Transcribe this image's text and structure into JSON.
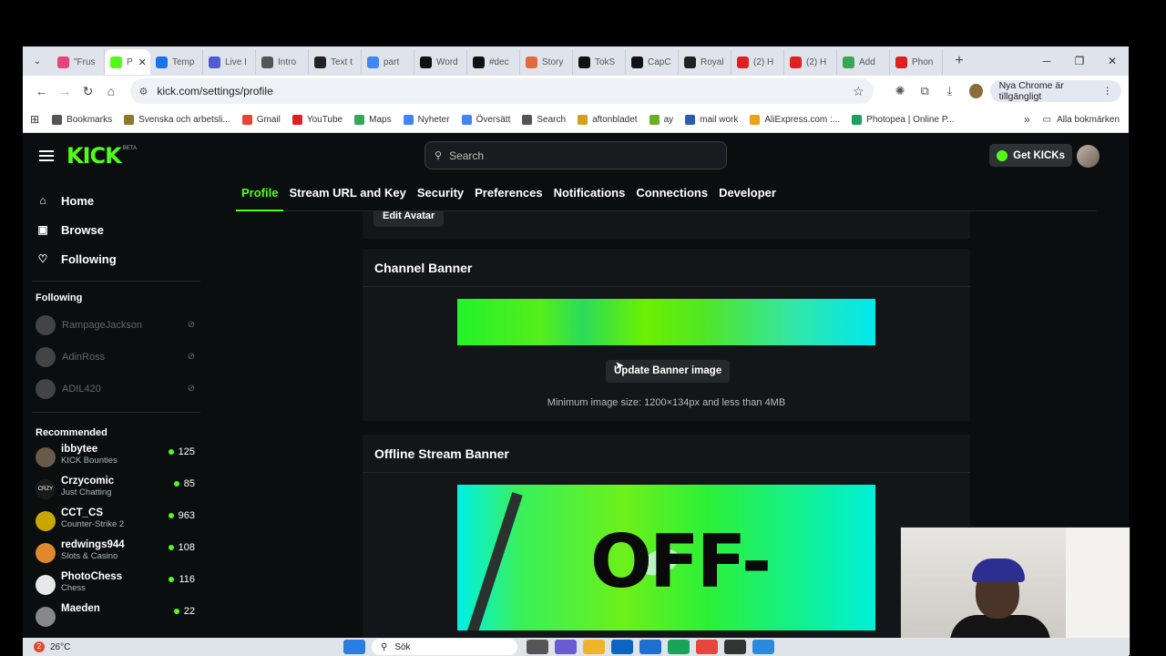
{
  "browser": {
    "tabs": [
      {
        "label": "\"Frus",
        "color": "#e8427a"
      },
      {
        "label": "P",
        "color": "#53fc18",
        "active": true
      },
      {
        "label": "Temp",
        "color": "#1a73e8"
      },
      {
        "label": "Live I",
        "color": "#4f5bd5"
      },
      {
        "label": "Intro",
        "color": "#555555"
      },
      {
        "label": "Text t",
        "color": "#222222"
      },
      {
        "label": "part",
        "color": "#4285f4"
      },
      {
        "label": "Word",
        "color": "#111111"
      },
      {
        "label": "#dec",
        "color": "#111111"
      },
      {
        "label": "Story",
        "color": "#e26a3a"
      },
      {
        "label": "TokS",
        "color": "#111111"
      },
      {
        "label": "CapC",
        "color": "#111111"
      },
      {
        "label": "Royal",
        "color": "#222222"
      },
      {
        "label": "(2) H",
        "color": "#e02020"
      },
      {
        "label": "(2) H",
        "color": "#e02020"
      },
      {
        "label": "Add",
        "color": "#34a853"
      },
      {
        "label": "Phon",
        "color": "#e02020"
      }
    ],
    "url": "kick.com/settings/profile",
    "update_text": "Nya Chrome är tillgängligt",
    "bookmarks": [
      {
        "label": "Bookmarks",
        "color": "#555555"
      },
      {
        "label": "Svenska och arbetsli...",
        "color": "#8a7a2c"
      },
      {
        "label": "Gmail",
        "color": "#ea4335"
      },
      {
        "label": "YouTube",
        "color": "#e02020"
      },
      {
        "label": "Maps",
        "color": "#34a853"
      },
      {
        "label": "Nyheter",
        "color": "#4285f4"
      },
      {
        "label": "Översätt",
        "color": "#4285f4"
      },
      {
        "label": "Search",
        "color": "#555555"
      },
      {
        "label": "aftonbladet",
        "color": "#d4a017"
      },
      {
        "label": "ay",
        "color": "#6ab023"
      },
      {
        "label": "mail work",
        "color": "#2a5db0"
      },
      {
        "label": "AliExpress.com :...",
        "color": "#e8a317"
      },
      {
        "label": "Photopea | Online P...",
        "color": "#19a35a"
      }
    ],
    "all_bookmarks": "Alla bokmärken"
  },
  "kick": {
    "logo": "KICK",
    "beta": "BETA",
    "search_placeholder": "Search",
    "get_kicks": "Get KICKs",
    "nav": [
      {
        "label": "Home",
        "icon": "home-icon",
        "glyph": "⌂"
      },
      {
        "label": "Browse",
        "icon": "browse-icon",
        "glyph": "▣"
      },
      {
        "label": "Following",
        "icon": "heart-icon",
        "glyph": "♡"
      }
    ],
    "following_header": "Following",
    "following": [
      {
        "name": "RampageJackson"
      },
      {
        "name": "AdinRoss"
      },
      {
        "name": "ADIL420"
      }
    ],
    "recommended_header": "Recommended",
    "recommended": [
      {
        "name": "ibbytee",
        "category": "KICK Bounties",
        "viewers": "125",
        "color": "#6a5a4a"
      },
      {
        "name": "Crzycomic",
        "category": "Just Chatting",
        "viewers": "85",
        "color": "#1a1a1a",
        "tag": "CRZY"
      },
      {
        "name": "CCT_CS",
        "category": "Counter-Strike 2",
        "viewers": "963",
        "color": "#c8a800"
      },
      {
        "name": "redwings944",
        "category": "Slots & Casino",
        "viewers": "108",
        "color": "#e0892c"
      },
      {
        "name": "PhotoChess",
        "category": "Chess",
        "viewers": "116",
        "color": "#e8e8e8"
      },
      {
        "name": "Maeden",
        "category": "",
        "viewers": "22",
        "color": "#888888"
      }
    ],
    "settings_tabs": [
      "Profile",
      "Stream URL and Key",
      "Security",
      "Preferences",
      "Notifications",
      "Connections",
      "Developer"
    ],
    "edit_avatar": "Edit Avatar",
    "channel_banner": {
      "title": "Channel Banner",
      "button": "Update Banner image",
      "hint": "Minimum image size: 1200×134px and less than 4MB"
    },
    "offline_banner": {
      "title": "Offline Stream Banner",
      "art_text": "OFF-"
    }
  },
  "taskbar": {
    "temp": "26°C",
    "badge": "2",
    "search": "Sök"
  }
}
